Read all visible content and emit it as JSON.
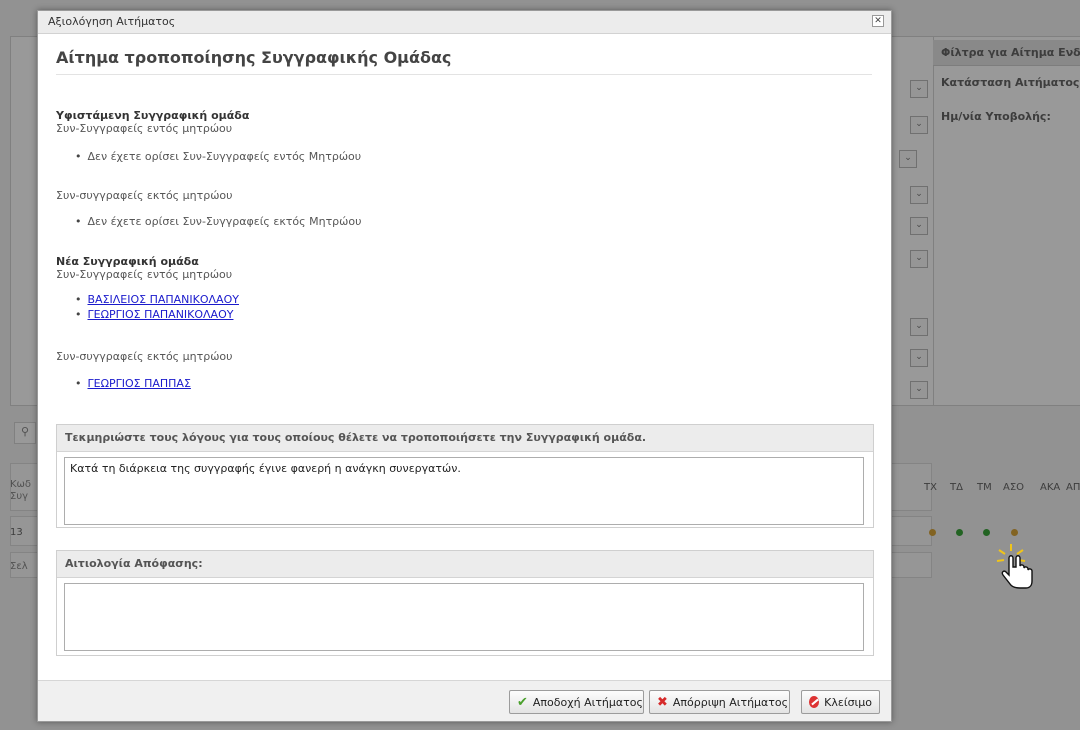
{
  "background": {
    "filter_panel_title": "Φίλτρα για Αίτημα Ενδ",
    "filter_status_label": "Κατάσταση Αιτήματος:",
    "filter_date_label": "Ημ/νία Υποβολής:",
    "table_headers": [
      "ΤΧ",
      "ΤΔ",
      "ΤΜ",
      "ΑΣΟ",
      "ΑΚΑ",
      "ΑΠ"
    ],
    "row_code_label_top": "Κωδ",
    "row_code_label_bottom": "Συγ",
    "row_code_value": "13",
    "pager_label": "Σελ",
    "status_dot_colors": [
      "#d9a53a",
      "#3aa53a",
      "#3aa53a",
      "#d9a53a"
    ]
  },
  "dialog": {
    "window_title": "Αξιολόγηση Αιτήματος",
    "close_glyph": "✕",
    "heading": "Αίτημα τροποποίησης Συγγραφικής Ομάδας",
    "existing_team": {
      "title": "Υφιστάμενη Συγγραφική ομάδα",
      "internal_label": "Συν-Συγγραφείς εντός μητρώου",
      "internal_items": [
        "Δεν έχετε ορίσει Συν-Συγγραφείς εντός Μητρώου"
      ],
      "external_label": "Συν-συγγραφείς εκτός μητρώου",
      "external_items": [
        "Δεν έχετε ορίσει Συν-Συγγραφείς εκτός Μητρώου"
      ]
    },
    "new_team": {
      "title": "Νέα Συγγραφική ομάδα",
      "internal_label": "Συν-Συγγραφείς εντός μητρώου",
      "internal_items": [
        "ΒΑΣΙΛΕΙΟΣ ΠΑΠΑΝΙΚΟΛΑΟΥ",
        "ΓΕΩΡΓΙΟΣ ΠΑΠΑΝΙΚΟΛΑΟΥ"
      ],
      "external_label": "Συν-συγγραφείς εκτός μητρώου",
      "external_items": [
        "ΓΕΩΡΓΙΟΣ ΠΑΠΠΑΣ"
      ]
    },
    "justification": {
      "label": "Τεκμηριώστε τους λόγους για τους οποίους θέλετε να τροποποιήσετε την Συγγραφική ομάδα.",
      "value": "Κατά τη διάρκεια της συγγραφής έγινε φανερή η ανάγκη συνεργατών."
    },
    "decision": {
      "label": "Αιτιολογία Απόφασης:",
      "value": ""
    },
    "buttons": {
      "accept": "Αποδοχή Αιτήματος",
      "reject": "Απόρριψη Αιτήματος",
      "close": "Κλείσιμο"
    }
  },
  "icons": {
    "accept": "check-icon",
    "reject": "x-icon",
    "close": "no-entry-icon",
    "search": "magnifier-icon",
    "pointer": "hand-pointer-icon"
  }
}
